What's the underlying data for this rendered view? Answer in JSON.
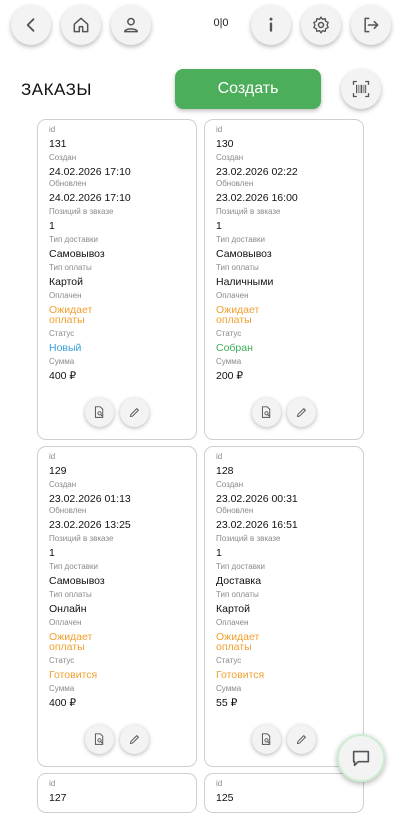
{
  "header": {
    "counter": "0|0",
    "title": "ЗАКАЗЫ",
    "create_label": "Создать"
  },
  "icons": {
    "back": "chevron-left-icon",
    "home": "home-icon",
    "profile": "person-icon",
    "info": "info-icon",
    "settings": "gear-icon",
    "logout": "logout-icon",
    "scan": "barcode-scan-icon",
    "chat": "chat-icon"
  },
  "colors": {
    "accent": "#4cae5b",
    "pending": "#f0a030",
    "status_new": "#3ba0e0",
    "status_collected": "#3cb05a"
  },
  "labels": {
    "id": "id",
    "created": "Создан",
    "updated": "Обновлен",
    "positions": "Позиций в звказе",
    "delivery": "Тип доставки",
    "payment": "Тип оплаты",
    "paid": "Оплачен",
    "status": "Статус",
    "sum": "Сумма"
  },
  "orders": [
    {
      "id": "131",
      "created": "24.02.2026 17:10",
      "updated": "24.02.2026 17:10",
      "positions": "1",
      "delivery": "Самовывоз",
      "payment": "Картой",
      "paid_line1": "Ожидает",
      "paid_line2": "оплаты",
      "status": "Новый",
      "sum": "400 ₽"
    },
    {
      "id": "130",
      "created": "23.02.2026 02:22",
      "updated": "23.02.2026 16:00",
      "positions": "1",
      "delivery": "Самовывоз",
      "payment": "Наличными",
      "paid_line1": "Ожидает",
      "paid_line2": "оплаты",
      "status": "Собран",
      "sum": "200 ₽"
    },
    {
      "id": "129",
      "created": "23.02.2026 01:13",
      "updated": "23.02.2026 13:25",
      "positions": "1",
      "delivery": "Самовывоз",
      "payment": "Онлайн",
      "paid_line1": "Ожидает",
      "paid_line2": "оплаты",
      "status": "Готовится",
      "sum": "400 ₽"
    },
    {
      "id": "128",
      "created": "23.02.2026 00:31",
      "updated": "23.02.2026 16:51",
      "positions": "1",
      "delivery": "Доставка",
      "payment": "Картой",
      "paid_line1": "Ожидает",
      "paid_line2": "оплаты",
      "status": "Готовится",
      "sum": "55 ₽"
    },
    {
      "id": "127"
    },
    {
      "id": "125"
    }
  ]
}
